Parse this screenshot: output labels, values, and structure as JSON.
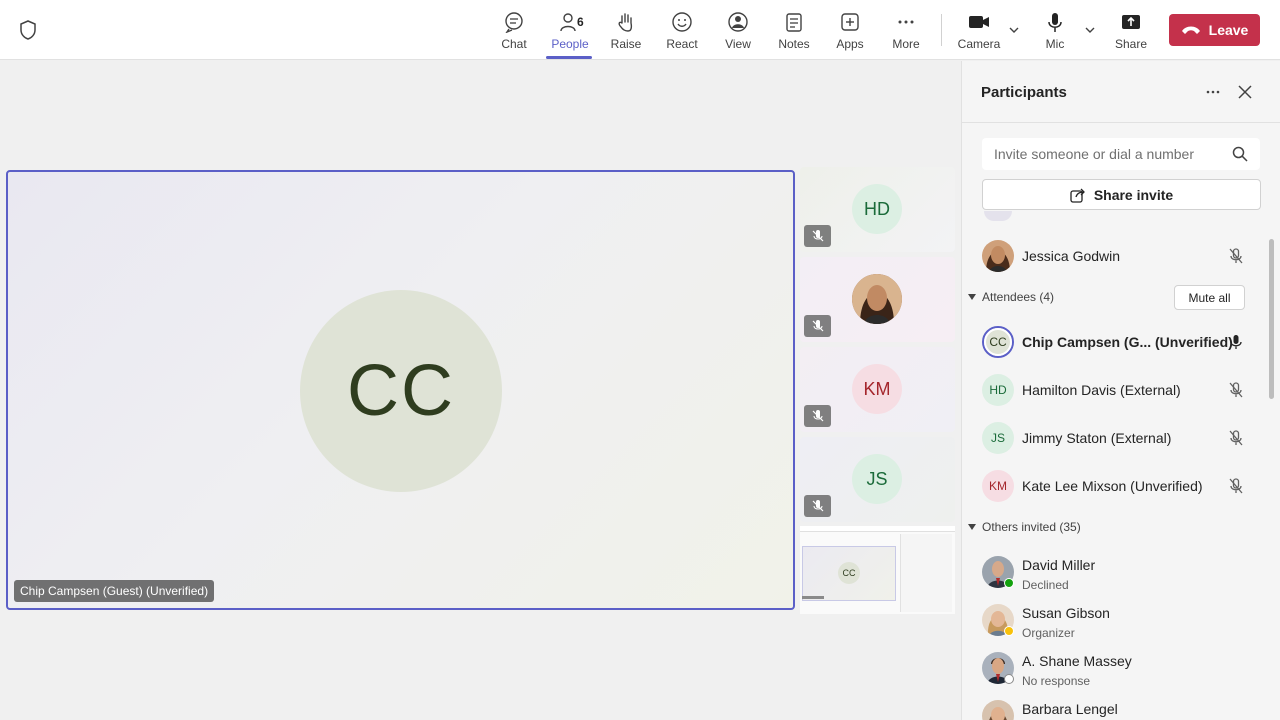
{
  "toolbar": {
    "people_count": "6",
    "items": [
      {
        "label": "Chat",
        "icon": "chat-icon"
      },
      {
        "label": "People",
        "icon": "people-icon"
      },
      {
        "label": "Raise",
        "icon": "raise-hand-icon"
      },
      {
        "label": "React",
        "icon": "react-icon"
      },
      {
        "label": "View",
        "icon": "view-icon"
      },
      {
        "label": "Notes",
        "icon": "notes-icon"
      },
      {
        "label": "Apps",
        "icon": "apps-icon"
      },
      {
        "label": "More",
        "icon": "more-icon"
      },
      {
        "label": "Camera",
        "icon": "camera-icon"
      },
      {
        "label": "Mic",
        "icon": "mic-icon"
      },
      {
        "label": "Share",
        "icon": "share-icon"
      }
    ],
    "leave_label": "Leave"
  },
  "stage": {
    "main_initials": "CC",
    "main_name": "Chip Campsen (Guest) (Unverified)",
    "thumbs": [
      {
        "initials": "HD",
        "color": "#dcefe3",
        "text_color": "#1b6b3a"
      },
      {
        "initials": "",
        "photo": true
      },
      {
        "initials": "KM",
        "color": "#f6dde3",
        "text_color": "#a4262c"
      },
      {
        "initials": "JS",
        "color": "#dcefe3",
        "text_color": "#1b6b3a"
      }
    ],
    "share_thumb_initials": "CC"
  },
  "panel": {
    "title": "Participants",
    "invite_placeholder": "Invite someone or dial a number",
    "share_invite_label": "Share invite",
    "presenter": {
      "name": "Jessica Godwin"
    },
    "attendees_label": "Attendees (4)",
    "mute_all_label": "Mute all",
    "attendees": [
      {
        "initials": "CC",
        "name": "Chip Campsen (G... (Unverified)"
      },
      {
        "initials": "HD",
        "name": "Hamilton Davis (External)"
      },
      {
        "initials": "JS",
        "name": "Jimmy Staton (External)"
      },
      {
        "initials": "KM",
        "name": "Kate Lee Mixson (Unverified)"
      }
    ],
    "others_label": "Others invited (35)",
    "others": [
      {
        "name": "David Miller",
        "status": "Declined"
      },
      {
        "name": "Susan Gibson",
        "status": "Organizer"
      },
      {
        "name": "A. Shane Massey",
        "status": "No response"
      },
      {
        "name": "Barbara Lengel",
        "status": ""
      }
    ]
  },
  "colors": {
    "accent": "#5b5fc7",
    "leave": "#c4314b"
  }
}
